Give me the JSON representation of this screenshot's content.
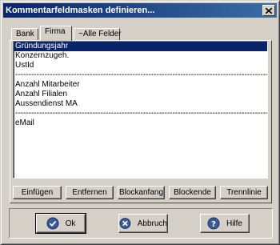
{
  "window": {
    "title": "Kommentarfeldmasken definieren..."
  },
  "tabs": [
    {
      "label": "Bank"
    },
    {
      "label": "Firma"
    },
    {
      "label": "~Alle Felder"
    }
  ],
  "list": {
    "items": [
      {
        "label": "Gründungsjahr",
        "selected": true
      },
      {
        "label": "Konzernzugeh."
      },
      {
        "label": "UstId"
      },
      {
        "label": "---------------------------------------------------------------------------------------------------"
      },
      {
        "label": "Anzahl Mitarbeiter"
      },
      {
        "label": "Anzahl Filialen"
      },
      {
        "label": "Aussendienst MA"
      },
      {
        "label": "---------------------------------------------------------------------------------------------------"
      },
      {
        "label": "eMail"
      }
    ]
  },
  "actions": {
    "insert": "Einfügen",
    "remove": "Entfernen",
    "block_start": "Blockanfang",
    "block_end": "Blockende",
    "separator": "Trennlinie"
  },
  "dialog": {
    "ok": "Ok",
    "cancel": "Abbruch",
    "help": "Hilfe"
  },
  "colors": {
    "titlebar": "#0a246a",
    "selection": "#0a246a",
    "face": "#d4d0c8"
  }
}
